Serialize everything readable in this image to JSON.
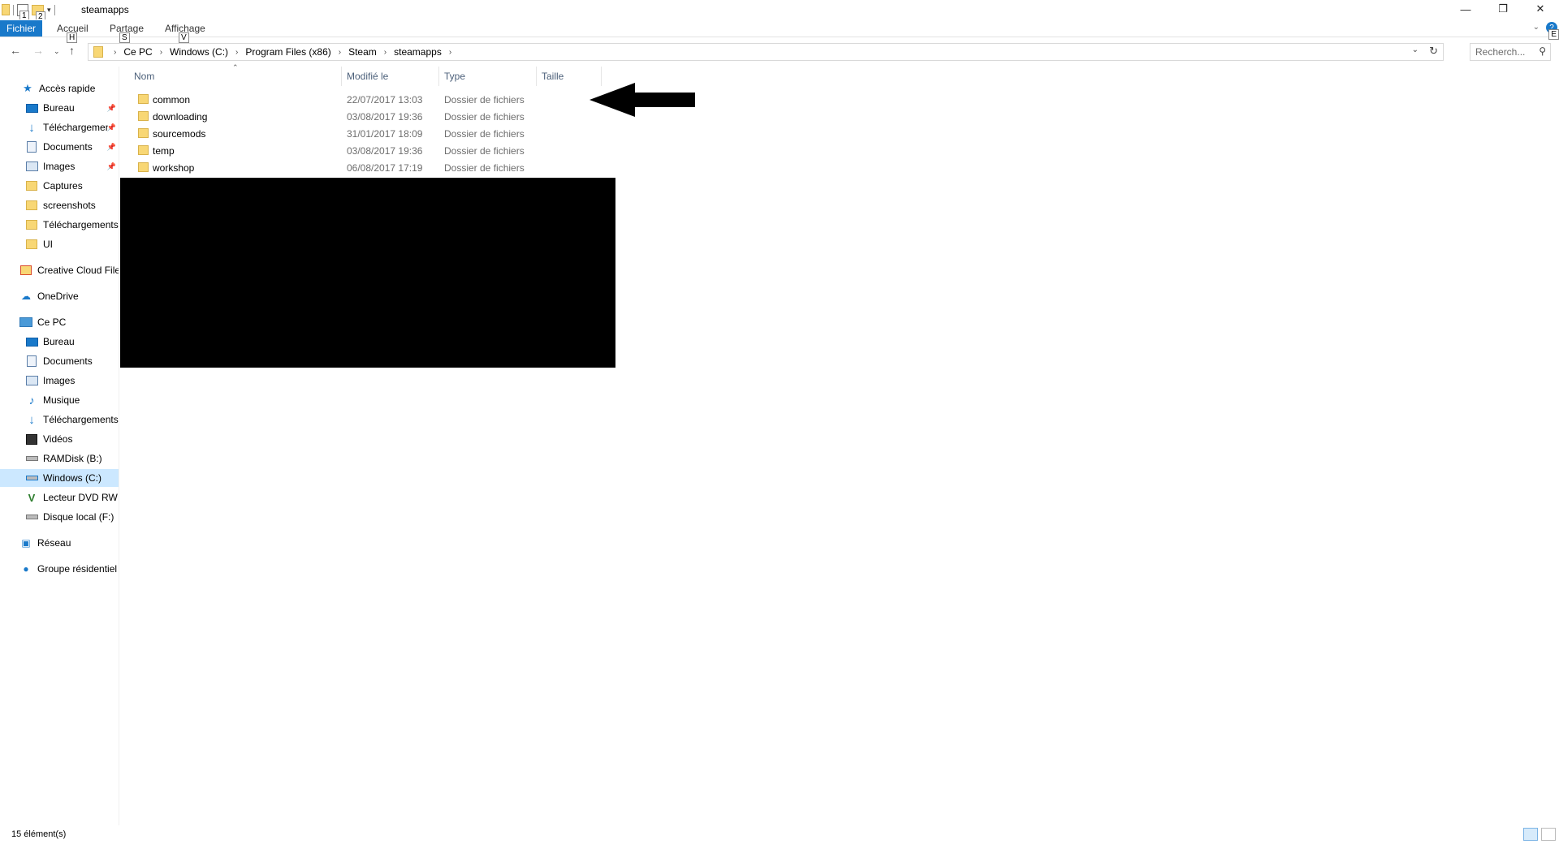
{
  "window": {
    "title": "steamapps"
  },
  "quick_access_toolbar": {
    "keytip_1": "1",
    "keytip_2": "2"
  },
  "ribbon": {
    "file_tab": "Fichier",
    "tabs": [
      {
        "label": "Accueil",
        "keytip": "H"
      },
      {
        "label": "Partage",
        "keytip": "S"
      },
      {
        "label": "Affichage",
        "keytip": "V"
      }
    ],
    "help_keytip": "E"
  },
  "address": {
    "crumbs": [
      "Ce PC",
      "Windows (C:)",
      "Program Files (x86)",
      "Steam",
      "steamapps"
    ]
  },
  "search": {
    "placeholder": "Recherch..."
  },
  "sidebar": {
    "items": [
      {
        "label": "Accès rapide",
        "icon": "star-icon"
      },
      {
        "label": "Bureau",
        "icon": "desktop-icon",
        "pinned": true
      },
      {
        "label": "Téléchargements",
        "icon": "download-icon",
        "pinned": true
      },
      {
        "label": "Documents",
        "icon": "documents-icon",
        "pinned": true
      },
      {
        "label": "Images",
        "icon": "images-icon",
        "pinned": true
      },
      {
        "label": "Captures",
        "icon": "folder-icon"
      },
      {
        "label": "screenshots",
        "icon": "folder-icon"
      },
      {
        "label": "Téléchargements",
        "icon": "folder-icon"
      },
      {
        "label": "UI",
        "icon": "folder-icon"
      },
      {
        "label": "Creative Cloud Files",
        "icon": "creative-cloud-folder-icon"
      },
      {
        "label": "OneDrive",
        "icon": "cloud-icon"
      },
      {
        "label": "Ce PC",
        "icon": "pc-icon"
      },
      {
        "label": "Bureau",
        "icon": "desktop-icon"
      },
      {
        "label": "Documents",
        "icon": "documents-icon"
      },
      {
        "label": "Images",
        "icon": "images-icon"
      },
      {
        "label": "Musique",
        "icon": "music-icon"
      },
      {
        "label": "Téléchargements",
        "icon": "download-icon"
      },
      {
        "label": "Vidéos",
        "icon": "video-icon"
      },
      {
        "label": "RAMDisk (B:)",
        "icon": "drive-icon"
      },
      {
        "label": "Windows (C:)",
        "icon": "windows-drive-icon",
        "selected": true
      },
      {
        "label": "Lecteur DVD RW (D:)",
        "icon": "dvd-icon"
      },
      {
        "label": "Disque local (F:)",
        "icon": "drive-icon"
      },
      {
        "label": "Réseau",
        "icon": "network-icon"
      },
      {
        "label": "Groupe résidentiel",
        "icon": "homegroup-icon"
      }
    ]
  },
  "columns": {
    "name": "Nom",
    "modified": "Modifié le",
    "type": "Type",
    "size": "Taille"
  },
  "files": [
    {
      "name": "common",
      "modified": "22/07/2017 13:03",
      "type": "Dossier de fichiers"
    },
    {
      "name": "downloading",
      "modified": "03/08/2017 19:36",
      "type": "Dossier de fichiers"
    },
    {
      "name": "sourcemods",
      "modified": "31/01/2017 18:09",
      "type": "Dossier de fichiers"
    },
    {
      "name": "temp",
      "modified": "03/08/2017 19:36",
      "type": "Dossier de fichiers"
    },
    {
      "name": "workshop",
      "modified": "06/08/2017 17:19",
      "type": "Dossier de fichiers"
    }
  ],
  "status": {
    "item_count": "15 élément(s)"
  },
  "colors": {
    "accent": "#1979ca",
    "selected_bg": "#cce8ff",
    "folder": "#f8d775"
  }
}
